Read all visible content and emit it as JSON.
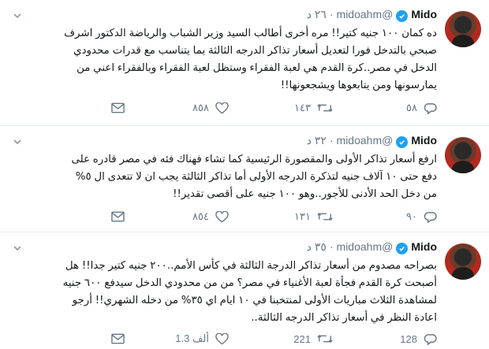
{
  "colors": {
    "accent": "#1da1f2",
    "muted": "#657786",
    "border": "#e6ecf0"
  },
  "icons": {
    "reply": "reply-icon",
    "retweet": "retweet-icon",
    "like": "heart-icon",
    "dm": "envelope-icon",
    "verified": "verified-badge-icon",
    "menu": "chevron-down-icon"
  },
  "tweets": [
    {
      "name": "Mido",
      "handle": "@midoahm",
      "sep": "·",
      "time": "٢٦ د",
      "lines": [
        "ده كمان ١٠٠ جنيه كتير!! مره أخرى أطالب السيد وزير الشباب والرياضة الدكتور اشرف",
        "صبحي بالتدخل فورا لتعديل أسعار تذاكر الدرجه الثالثة بما يتناسب مع قدرات محدودي",
        "الدخل في مصر..كرة القدم هي لعبة  الفقراء وستظل لعبة الفقراء وبالفقراء اعني من",
        "يمارسونها ومن يتابعوها ويشجعونها!!"
      ],
      "replies": "٥٨",
      "retweets": "١٤٣",
      "likes": "٨٥٨"
    },
    {
      "name": "Mido",
      "handle": "@midoahm",
      "sep": "·",
      "time": "٣٢ د",
      "lines": [
        "ارفع أسعار تذاكر الأولى والمقصورة الرئيسية كما تشاء فهناك فئه في مصر قادره على",
        "دفع حتى ١٠ آلاف جنيه لتذكرة الدرجه الأولى أما تذاكر الثالثة يجب ان لا تتعدى ال ٥%",
        "من دخل الحد الأدنى للأجور..وهو ١٠٠ جنيه على أقصى تقدير!!"
      ],
      "replies": "٩٠",
      "retweets": "١٣١",
      "likes": "٨٥٤"
    },
    {
      "name": "Mido",
      "handle": "@midoahm",
      "sep": "·",
      "time": "٣٥ د",
      "lines": [
        "بصراحه مصدوم من أسعار تذاكر الدرجة الثالثة في كأس الأمم..٢٠٠ جنيه كتير جدا!! هل",
        "أصبحت كرة القدم فجأة لعبة الأغنياء في مصر؟ من من محدودي الدخل سيدفع ٦٠٠ جنيه",
        "لمشاهدة الثلاث مباريات الأولى لمنتخبنا في ١٠ ايام اي ٣٥% من دخله الشهري!! أرجو",
        "اعادة النظر في أسعار تذاكر الدرجه الثالثة.."
      ],
      "replies": "128",
      "retweets": "221",
      "likes": "1.3 ألف"
    }
  ]
}
